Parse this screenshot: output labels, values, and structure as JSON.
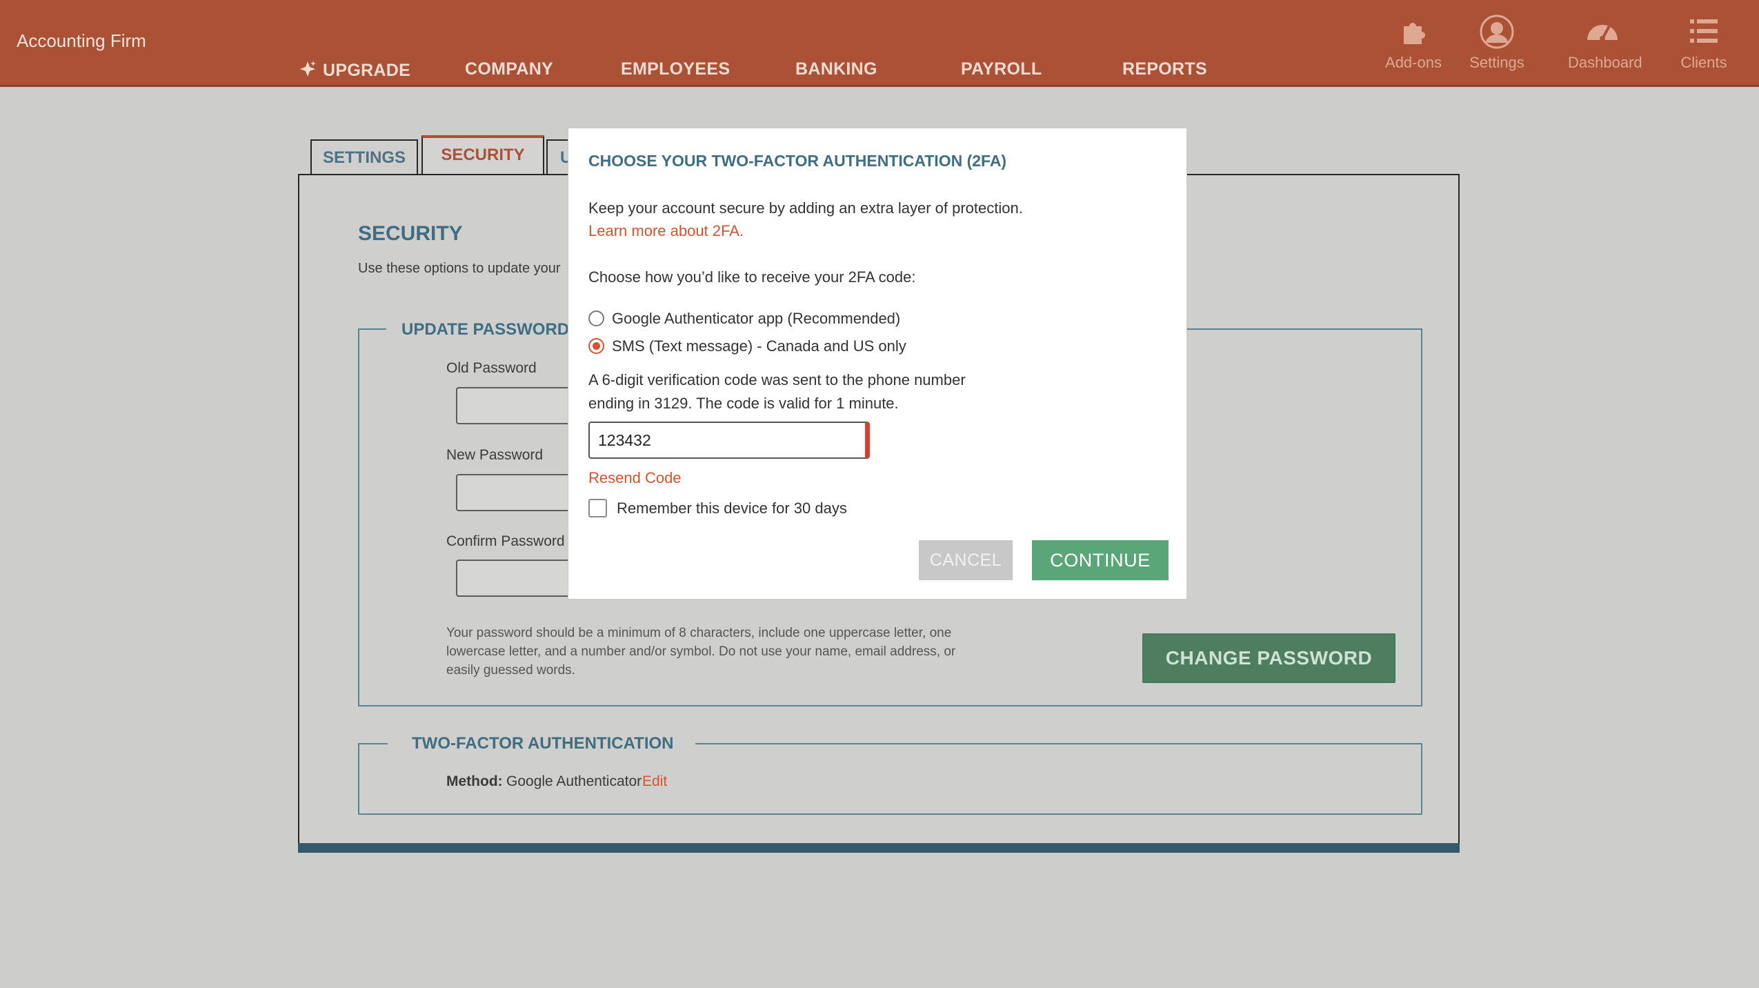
{
  "topbar": {
    "firm_name": "Accounting Firm",
    "nav": [
      {
        "label": "UPGRADE",
        "icon": "sparkle-icon"
      },
      {
        "label": "COMPANY"
      },
      {
        "label": "EMPLOYEES"
      },
      {
        "label": "BANKING"
      },
      {
        "label": "PAYROLL"
      },
      {
        "label": "REPORTS"
      }
    ],
    "icons": [
      {
        "label": "Add-ons",
        "icon": "puzzle-icon"
      },
      {
        "label": "Settings",
        "icon": "user-circle-icon"
      },
      {
        "label": "Dashboard",
        "icon": "gauge-icon"
      },
      {
        "label": "Clients",
        "icon": "list-icon"
      }
    ]
  },
  "tabs": [
    {
      "label": "SETTINGS"
    },
    {
      "label": "SECURITY",
      "active": true
    },
    {
      "label": "U"
    }
  ],
  "security": {
    "title": "SECURITY",
    "description": "Use these options to update your",
    "update_password": {
      "legend": "UPDATE PASSWORD",
      "old_label": "Old Password",
      "new_label": "New Password",
      "confirm_label": "Confirm Password",
      "hint_lines": [
        "Your password should be a minimum of 8 characters, include one uppercase letter, one",
        "lowercase letter, and a number and/or symbol. Do not use your name, email address, or",
        "easily guessed words."
      ],
      "change_button": "CHANGE PASSWORD"
    },
    "two_factor": {
      "legend": "TWO-FACTOR AUTHENTICATION",
      "method_label": "Method:",
      "method_value": "Google Authenticator",
      "edit_link": "Edit"
    }
  },
  "modal": {
    "title": "CHOOSE YOUR TWO-FACTOR AUTHENTICATION (2FA)",
    "intro": "Keep your account secure by adding an extra layer of protection.",
    "learn_more": "Learn more about 2FA.",
    "choose_prompt": "Choose how you’d like to receive your 2FA code:",
    "options": [
      {
        "label": "Google Authenticator app (Recommended)",
        "selected": false
      },
      {
        "label": "SMS (Text message) - Canada and US only",
        "selected": true
      }
    ],
    "sent_message_lines": [
      "A 6-digit verification code was sent to the phone number",
      "ending in 3129. The code is valid for 1 minute."
    ],
    "code_value": "123432",
    "resend": "Resend Code",
    "remember": "Remember this device for 30 days",
    "cancel": "CANCEL",
    "continue": "CONTINUE"
  },
  "colors": {
    "brand": "#ab5236",
    "accent_link": "#d5532e",
    "heading": "#3f6e82",
    "continue_green": "#5aa678"
  }
}
